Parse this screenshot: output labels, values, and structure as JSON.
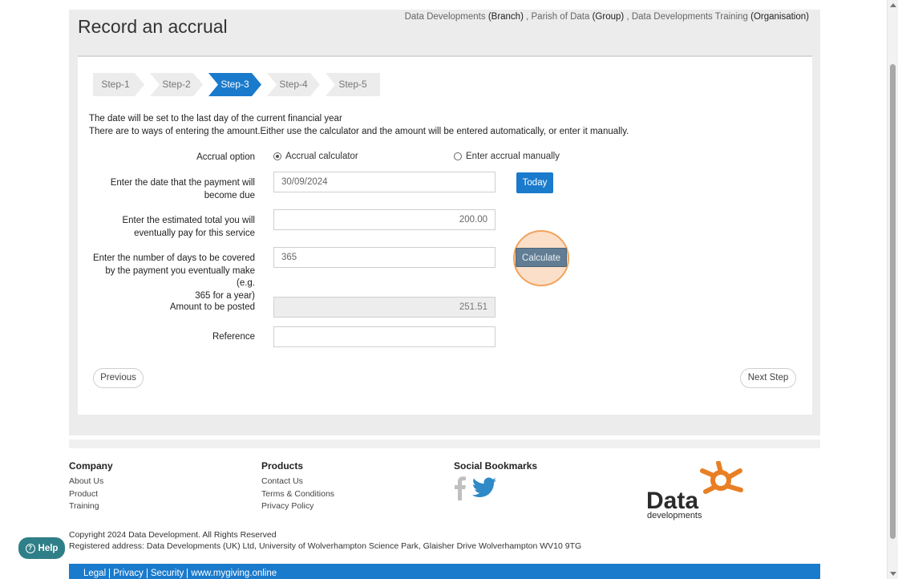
{
  "page": {
    "title": "Record an accrual",
    "context": [
      {
        "name": "Data Developments",
        "type": "(Branch)"
      },
      {
        "name": "Parish of Data",
        "type": "(Group)"
      },
      {
        "name": "Data Developments Training",
        "type": "(Organisation)"
      }
    ]
  },
  "steps": [
    "Step-1",
    "Step-2",
    "Step-3",
    "Step-4",
    "Step-5"
  ],
  "active_step": "Step-3",
  "intro": {
    "line1": "The date will be set to the last day of the current financial year",
    "line2": "There are to ways of entering the amount.Either use the calculator and the amount will be entered automatically, or enter it manually."
  },
  "form": {
    "accrual_option_label": "Accrual option",
    "option_calculator": "Accrual calculator",
    "option_manual": "Enter accrual manually",
    "selected_option": "Accrual calculator",
    "due_date_label_1": "Enter the date that the payment will",
    "due_date_label_2": "become due",
    "due_date_value": "30/09/2024",
    "today_button": "Today",
    "estimated_total_label_1": "Enter the estimated total you will",
    "estimated_total_label_2": "eventually pay for this service",
    "estimated_total_value": "200.00",
    "days_label_1": "Enter the number of days to be covered",
    "days_label_2": "by the payment you eventually make (e.g.",
    "days_label_3": "365 for a year)",
    "days_value": "365",
    "calculate_button": "Calculate",
    "amount_label": "Amount to be posted",
    "amount_value": "251.51",
    "reference_label": "Reference",
    "reference_value": ""
  },
  "nav": {
    "previous": "Previous",
    "next": "Next Step"
  },
  "footer": {
    "company": {
      "heading": "Company",
      "links": [
        "About Us",
        "Product",
        "Training"
      ]
    },
    "products": {
      "heading": "Products",
      "links": [
        "Contact Us",
        "Terms & Conditions",
        "Privacy Policy"
      ]
    },
    "social": {
      "heading": "Social Bookmarks",
      "icons": [
        "facebook-icon",
        "twitter-icon"
      ]
    },
    "logo": {
      "word": "Data",
      "sub": "developments"
    },
    "copyright": "Copyright 2024 Data Development. All Rights Reserved",
    "address": "Registered address: Data Developments (UK) Ltd, University of Wolverhampton Science Park, Glaisher Drive Wolverhampton WV10 9TG",
    "bottom_links": [
      "Legal",
      "Privacy",
      "Security",
      "www.mygiving.online"
    ]
  },
  "help_button": "Help",
  "colors": {
    "accent": "#1a7acc",
    "calculate": "#627d93",
    "highlight": "#f2a35c",
    "logo_orange": "#e87f24",
    "logo_text": "#2b2b2b",
    "help": "#2f7f88"
  }
}
